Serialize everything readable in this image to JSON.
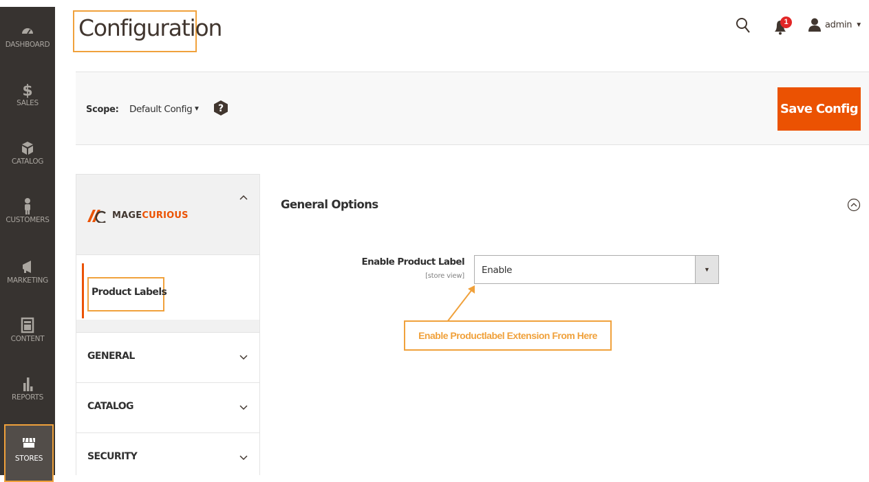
{
  "menu": {
    "items": [
      {
        "label": "DASHBOARD",
        "icon": "dashboard-icon"
      },
      {
        "label": "SALES",
        "icon": "dollar-icon"
      },
      {
        "label": "CATALOG",
        "icon": "box-icon"
      },
      {
        "label": "CUSTOMERS",
        "icon": "person-icon"
      },
      {
        "label": "MARKETING",
        "icon": "megaphone-icon"
      },
      {
        "label": "CONTENT",
        "icon": "layout-icon"
      },
      {
        "label": "REPORTS",
        "icon": "bar-chart-icon"
      },
      {
        "label": "STORES",
        "icon": "store-icon",
        "active": true
      }
    ]
  },
  "header": {
    "title": "Configuration",
    "notification_count": "1",
    "user_name": "admin"
  },
  "scope": {
    "label": "Scope:",
    "value": "Default Config",
    "save_label": "Save Config"
  },
  "config_nav": {
    "brand": "MAGECURIOUS",
    "brand_accent": "CURIOUS",
    "active_item": "Product Labels",
    "sections": [
      "GENERAL",
      "CATALOG",
      "SECURITY"
    ]
  },
  "main": {
    "section_title": "General Options",
    "field_label": "Enable Product Label",
    "field_scope": "[store view]",
    "field_value": "Enable",
    "annotation": "Enable Productlabel Extension From Here"
  },
  "colors": {
    "menu_bg": "#373330",
    "accent_orange": "#eb5202",
    "highlight": "#f0a13b",
    "badge_red": "#e22626"
  }
}
